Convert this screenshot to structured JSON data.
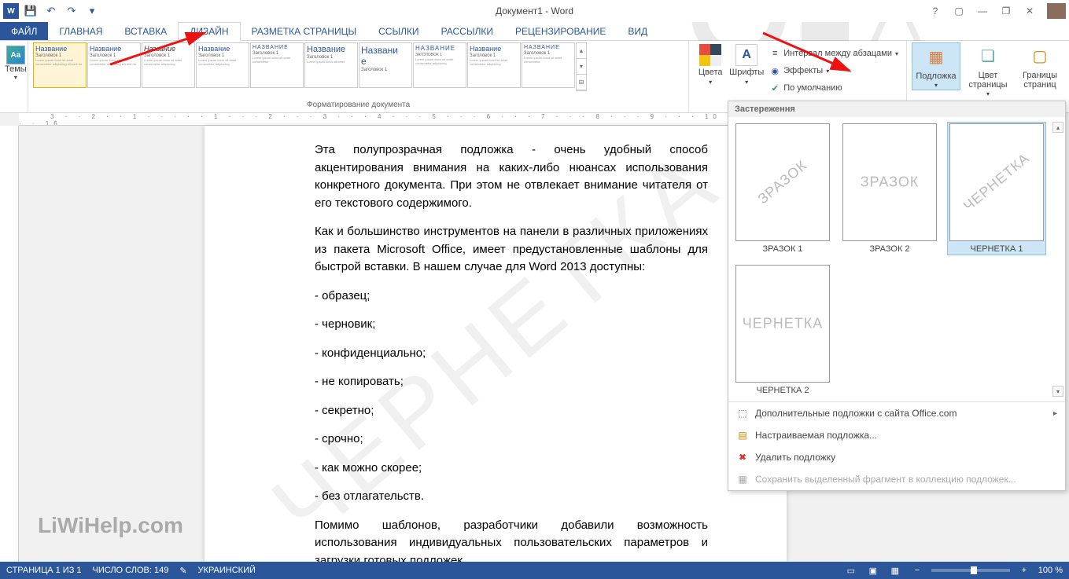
{
  "title": "Документ1 - Word",
  "qat": {
    "save": "💾",
    "undo": "↶",
    "redo": "↷",
    "more": "▾"
  },
  "winbtns": {
    "help": "?",
    "ribbonopt": "▢",
    "min": "—",
    "restore": "❐",
    "close": "✕"
  },
  "tabs": {
    "file": "ФАЙЛ",
    "items": [
      "ГЛАВНАЯ",
      "ВСТАВКА",
      "ДИЗАЙН",
      "РАЗМЕТКА СТРАНИЦЫ",
      "ССЫЛКИ",
      "РАССЫЛКИ",
      "РЕЦЕНЗИРОВАНИЕ",
      "ВИД"
    ],
    "active_index": 2
  },
  "ribbon": {
    "themes": "Темы",
    "styles_title": "Название",
    "styles_sub": "Заголовок 1",
    "gallery_label": "Форматирование документа",
    "colors": "Цвета",
    "fonts": "Шрифты",
    "paragraph_spacing": "Интервал между абзацами",
    "effects": "Эффекты",
    "set_default": "По умолчанию",
    "watermark": "Подложка",
    "page_color": "Цвет страницы",
    "page_borders": "Границы страниц"
  },
  "document": {
    "watermark_bg": "ЧЕРНЕТКА",
    "p1": "Эта полупрозрачная подложка - очень удобный способ акцентирования внимания на каких-либо нюансах использования конкретного документа. При этом не отвлекает внимание читателя от его текстового содержимого.",
    "p2": "Как и большинство инструментов на панели в различных приложениях из пакета Microsoft Office, имеет предустановленные шаблоны для быстрой вставки. В нашем случае для Word 2013 доступны:",
    "list": [
      "- образец;",
      "- черновик;",
      "- конфиденциально;",
      "- не копировать;",
      "- секретно;",
      "- срочно;",
      "- как можно скорее;",
      "- без отлагательств."
    ],
    "p3": "Помимо шаблонов, разработчики добавили возможность использования индивидуальных пользовательских параметров и загрузки готовых подложек"
  },
  "overlay_logo": "LiWiHelp.com",
  "watermark_panel": {
    "header": "Застереження",
    "items": [
      {
        "text": "ЗРАЗОК",
        "orient": "diag",
        "label": "ЗРАЗОК 1"
      },
      {
        "text": "ЗРАЗОК",
        "orient": "horz",
        "label": "ЗРАЗОК 2"
      },
      {
        "text": "ЧЕРНЕТКА",
        "orient": "diag",
        "label": "ЧЕРНЕТКА 1",
        "selected": true
      },
      {
        "text": "ЧЕРНЕТКА",
        "orient": "horz",
        "label": "ЧЕРНЕТКА 2"
      }
    ],
    "menu": {
      "more_office": "Дополнительные подложки с сайта Office.com",
      "custom": "Настраиваемая подложка...",
      "remove": "Удалить подложку",
      "save_selection": "Сохранить выделенный фрагмент в коллекцию подложек..."
    }
  },
  "statusbar": {
    "page": "СТРАНИЦА 1 ИЗ 1",
    "words": "ЧИСЛО СЛОВ: 149",
    "lang": "УКРАИНСКИЙ",
    "zoom": "100 %"
  },
  "ruler_marks": "3 · · 2 · · 1 · · · · · 1 · · · 2 · · · 3 · · · 4 · · · 5 · · · 6 · · · 7 · · · 8 · · · 9 · · · 10 · · · 11 · · · 12 · · · 13 · · · 14 · · · 15 · · · 16"
}
